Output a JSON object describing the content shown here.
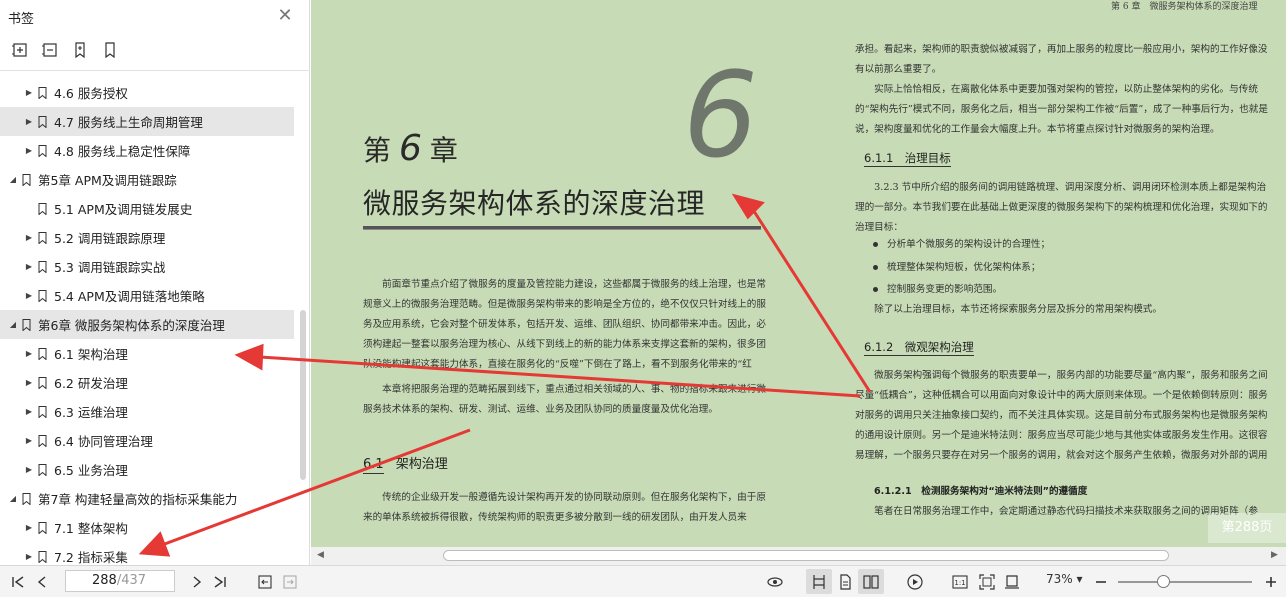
{
  "sidebar": {
    "title": "书签",
    "close_glyph": "✕",
    "tools": [
      "expand-all-icon",
      "collapse-all-icon",
      "add-bookmark-icon",
      "bookmark-icon"
    ],
    "items": [
      {
        "level": 2,
        "label": "4.6 服务授权",
        "expand": "▶",
        "selected": false
      },
      {
        "level": 2,
        "label": "4.7 服务线上生命周期管理",
        "expand": "▶",
        "selected": true
      },
      {
        "level": 2,
        "label": "4.8 服务线上稳定性保障",
        "expand": "▶",
        "selected": false
      },
      {
        "level": 1,
        "label": "第5章 APM及调用链跟踪",
        "expand": "◢",
        "selected": false
      },
      {
        "level": 2,
        "label": "5.1 APM及调用链发展史",
        "expand": "",
        "selected": false
      },
      {
        "level": 2,
        "label": "5.2 调用链跟踪原理",
        "expand": "▶",
        "selected": false
      },
      {
        "level": 2,
        "label": "5.3 调用链跟踪实战",
        "expand": "▶",
        "selected": false
      },
      {
        "level": 2,
        "label": "5.4 APM及调用链落地策略",
        "expand": "▶",
        "selected": false
      },
      {
        "level": 1,
        "label": "第6章 微服务架构体系的深度治理",
        "expand": "◢",
        "selected": true
      },
      {
        "level": 2,
        "label": "6.1 架构治理",
        "expand": "▶",
        "selected": false
      },
      {
        "level": 2,
        "label": "6.2 研发治理",
        "expand": "▶",
        "selected": false
      },
      {
        "level": 2,
        "label": "6.3 运维治理",
        "expand": "▶",
        "selected": false
      },
      {
        "level": 2,
        "label": "6.4 协同管理治理",
        "expand": "▶",
        "selected": false
      },
      {
        "level": 2,
        "label": "6.5 业务治理",
        "expand": "▶",
        "selected": false
      },
      {
        "level": 1,
        "label": "第7章 构建轻量高效的指标采集能力",
        "expand": "◢",
        "selected": false
      },
      {
        "level": 2,
        "label": "7.1 整体架构",
        "expand": "▶",
        "selected": false
      },
      {
        "level": 2,
        "label": "7.2 指标采集",
        "expand": "▶",
        "selected": false
      }
    ]
  },
  "bottom": {
    "current_page": "288",
    "total_pages": "/437",
    "zoom": "73%",
    "zoom_dropdown": "▾",
    "zoom_level_fraction": 0.34
  },
  "doc": {
    "running_head": "第 6 章　微服务架构体系的深度治理",
    "chapter_word1": "第",
    "chapter_num": "6",
    "chapter_word2": "章",
    "big_number": "6",
    "chapter_title": "微服务架构体系的深度治理",
    "left_para1": "　　前面章节重点介绍了微服务的度量及管控能力建设，这些都属于微服务的线上治理，也是常规意义上的微服务治理范畴。但是微服务架构带来的影响是全方位的，绝不仅仅只针对线上的服务及应用系统，它会对整个研发体系，包括开发、运维、团队组织、协同都带来冲击。因此，必须构建起一整套以服务治理为核心、从线下到线上的新的能力体系来支撑这套新的架构，很多团队没能构建起这套能力体系，直接在服务化的“反噬”下倒在了路上，看不到服务化带来的“红利”。",
    "left_para2": "　　本章将把服务治理的范畴拓展到线下，重点通过相关领域的人、事、物的指标来跟来进行微服务技术体系的架构、研发、测试、运维、业务及团队协同的质量度量及优化治理。",
    "sec61_num": "6.1",
    "sec61_title": "架构治理",
    "left_para3": "　　传统的企业级开发一般遵循先设计架构再开发的协同联动原则。但在服务化架构下，由于原来的单体系统被拆得很散，传统架构师的职责更多被分散到一线的研发团队，由开发人员来",
    "right_para1": "承担。看起来，架构师的职责貌似被减弱了，再加上服务的粒度比一般应用小，架构的工作好像没有以前那么重要了。",
    "right_para2": "　　实际上恰恰相反，在离散化体系中更要加强对架构的管控，以防止整体架构的劣化。与传统的“架构先行”模式不同，服务化之后，相当一部分架构工作被“后置”，成了一种事后行为，也就是说，架构度量和优化的工作量会大幅度上升。本节将重点探讨针对微服务的架构治理。",
    "sec611": "6.1.1　治理目标",
    "right_para3": "　　3.2.3 节中所介绍的服务间的调用链路梳理、调用深度分析、调用闭环检测本质上都是架构治理的一部分。本节我们要在此基础上做更深度的微服务架构下的架构梳理和优化治理，实现如下的治理目标：",
    "bullets": [
      "分析单个微服务的架构设计的合理性；",
      "梳理整体架构短板，优化架构体系；",
      "控制服务变更的影响范围。"
    ],
    "right_para4": "　　除了以上治理目标，本节还将探索服务分层及拆分的常用架构模式。",
    "sec612": "6.1.2　微观架构治理",
    "right_para5": "　　微服务架构强调每个微服务的职责要单一，服务内部的功能要尽量“高内聚”，服务和服务之间尽量“低耦合”，这种低耦合可以用面向对象设计中的两大原则来体现。一个是依赖倒转原则：服务对服务的调用只关注抽象接口契约，而不关注具体实现。这是目前分布式服务架构也是微服务架构的通用设计原则。另一个是迪米特法则：服务应当尽可能少地与其他实体或服务发生作用。这很容易理解，一个服务只要存在对另一个服务的调用，就会对这个服务产生依赖，微服务对外部的调用越少，它的自治性越好。",
    "sec6121": "6.1.2.1　检测服务架构对“迪米特法则”的遵循度",
    "right_para6": "　　笔者在日常服务治理工作中，会定期通过静态代码扫描技术来获取服务之间的调用矩阵（参",
    "page_badge": "第288页"
  },
  "colors": {
    "page_bg": "#c7dcb6",
    "arrow": "#e53935",
    "selected_bg": "#e6e6e6"
  }
}
